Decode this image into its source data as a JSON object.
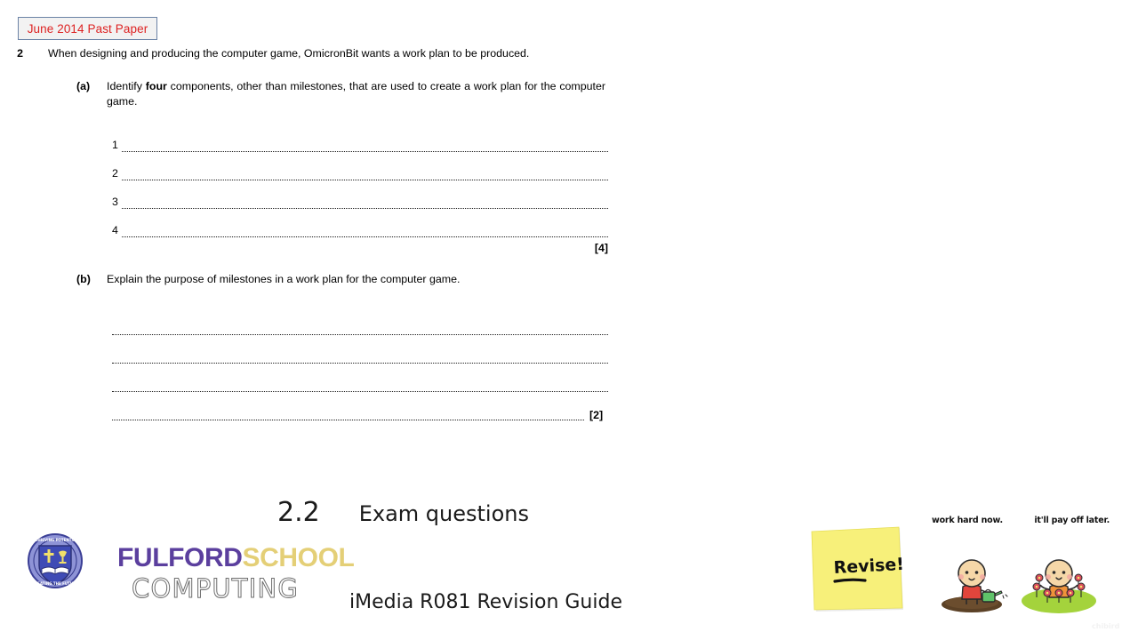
{
  "badge": {
    "label": "June 2014  Past Paper"
  },
  "question": {
    "number": "2",
    "stem": "When designing and producing the computer game, OmicronBit wants a work plan to be produced.",
    "parts": [
      {
        "label": "(a)",
        "text_before": "Identify ",
        "emphasis": "four",
        "text_after": " components, other than milestones, that are used to create a work plan for the computer game.",
        "answer_numbers": [
          "1",
          "2",
          "3",
          "4"
        ],
        "marks": "[4]"
      },
      {
        "label": "(b)",
        "text": "Explain the purpose of milestones in a work plan for the computer game.",
        "line_count": 4,
        "marks": "[2]"
      }
    ]
  },
  "footer": {
    "section_number": "2.2",
    "section_title": "Exam questions",
    "guide_title": "iMedia R081 Revision Guide"
  },
  "logo": {
    "word_primary": "FULFORD",
    "word_secondary": "SCHOOL",
    "word_outline": "COMPUTING",
    "colors": {
      "primary": "#5b3f9e",
      "secondary": "#e4cf77",
      "outline": "#6e6e6e",
      "crest_ring": "#4a4fa8",
      "crest_shield": "#3f4bb5"
    }
  },
  "sticky_note": {
    "text": "Revise!",
    "color": "#f7f07a"
  },
  "motivation": {
    "caption_left": "work hard now.",
    "caption_right": "it'll pay off later.",
    "watermark": "chibird",
    "colors": {
      "skin": "#f5d7a8",
      "soil": "#5b4126",
      "grass": "#a4d33c",
      "shirt_left": "#e2453c",
      "shirt_right": "#f0923a",
      "watering_can": "#5fc36a"
    }
  },
  "theme": {
    "badge_border": "#6b83a6",
    "badge_background": "#f2f2f2",
    "badge_text": "#dd2222",
    "page_background": "#ffffff",
    "text": "#000000"
  }
}
